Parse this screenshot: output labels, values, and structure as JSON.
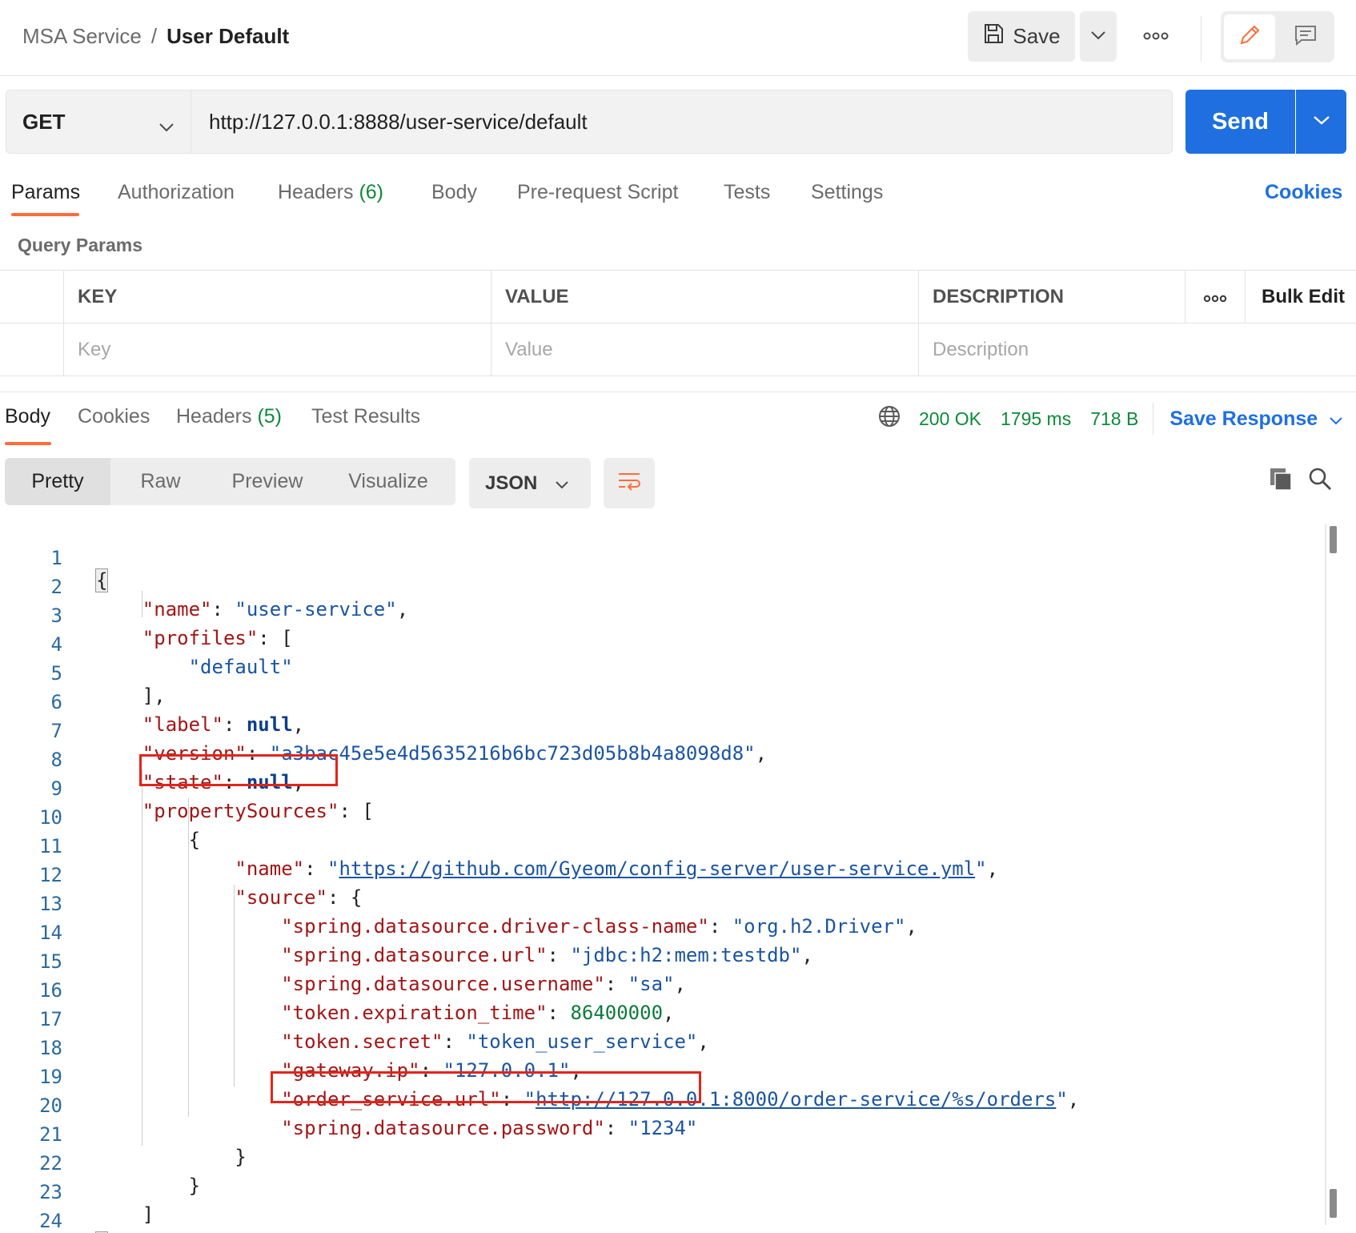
{
  "header": {
    "collection": "MSA Service",
    "separator": "/",
    "request_name": "User Default",
    "save_label": "Save"
  },
  "request": {
    "method": "GET",
    "url": "http://127.0.0.1:8888/user-service/default",
    "send_label": "Send"
  },
  "request_tabs": {
    "params": "Params",
    "authorization": "Authorization",
    "headers": "Headers",
    "headers_count": "(6)",
    "body": "Body",
    "pre_request": "Pre-request Script",
    "tests": "Tests",
    "settings": "Settings",
    "cookies": "Cookies"
  },
  "query_params": {
    "title": "Query Params",
    "columns": {
      "key": "KEY",
      "value": "VALUE",
      "description": "DESCRIPTION",
      "bulk_edit": "Bulk Edit"
    },
    "placeholders": {
      "key": "Key",
      "value": "Value",
      "description": "Description"
    }
  },
  "response_tabs": {
    "body": "Body",
    "cookies": "Cookies",
    "headers": "Headers",
    "headers_count": "(5)",
    "test_results": "Test Results"
  },
  "response_status": {
    "status": "200 OK",
    "time": "1795 ms",
    "size": "718 B",
    "save_response": "Save Response"
  },
  "response_view": {
    "modes": {
      "pretty": "Pretty",
      "raw": "Raw",
      "preview": "Preview",
      "visualize": "Visualize"
    },
    "format": "JSON"
  },
  "colors": {
    "accent_orange": "#ff6c37",
    "send_blue": "#1f6fe0",
    "status_green": "#0d8a39",
    "json_key": "#a31515",
    "json_string": "#1a54a3",
    "highlight_red": "#e1251b"
  },
  "code": {
    "line_numbers": [
      "1",
      "2",
      "3",
      "4",
      "5",
      "6",
      "7",
      "8",
      "9",
      "10",
      "11",
      "12",
      "13",
      "14",
      "15",
      "16",
      "17",
      "18",
      "19",
      "20",
      "21",
      "22",
      "23",
      "24"
    ],
    "tokens": {
      "name_key": "\"name\"",
      "name_val": "\"user-service\"",
      "profiles_key": "\"profiles\"",
      "default_val": "\"default\"",
      "label_key": "\"label\"",
      "null_kw": "null",
      "version_key": "\"version\"",
      "version_val": "\"a3bac45e5e4d5635216b6bc723d05b8b4a8098d8\"",
      "state_key": "\"state\"",
      "property_sources_key": "\"propertySources\"",
      "ps_name_key": "\"name\"",
      "ps_name_url": "https://github.com/Gyeom/config-server/user-service.yml",
      "source_key": "\"source\"",
      "driver_key": "\"spring.datasource.driver-class-name\"",
      "driver_val": "\"org.h2.Driver\"",
      "url_key": "\"spring.datasource.url\"",
      "url_val": "\"jdbc:h2:mem:testdb\"",
      "username_key": "\"spring.datasource.username\"",
      "username_val": "\"sa\"",
      "expiration_key": "\"token.expiration_time\"",
      "expiration_val": "86400000",
      "secret_key": "\"token.secret\"",
      "secret_val": "\"token_user_service\"",
      "gateway_key": "\"gateway.ip\"",
      "gateway_val": "\"127.0.0.1\"",
      "order_key": "\"order_service.url\"",
      "order_url": "http://127.0.0.1:8000/order-service/%s/orders",
      "password_key": "\"spring.datasource.password\"",
      "password_val": "\"1234\""
    }
  }
}
